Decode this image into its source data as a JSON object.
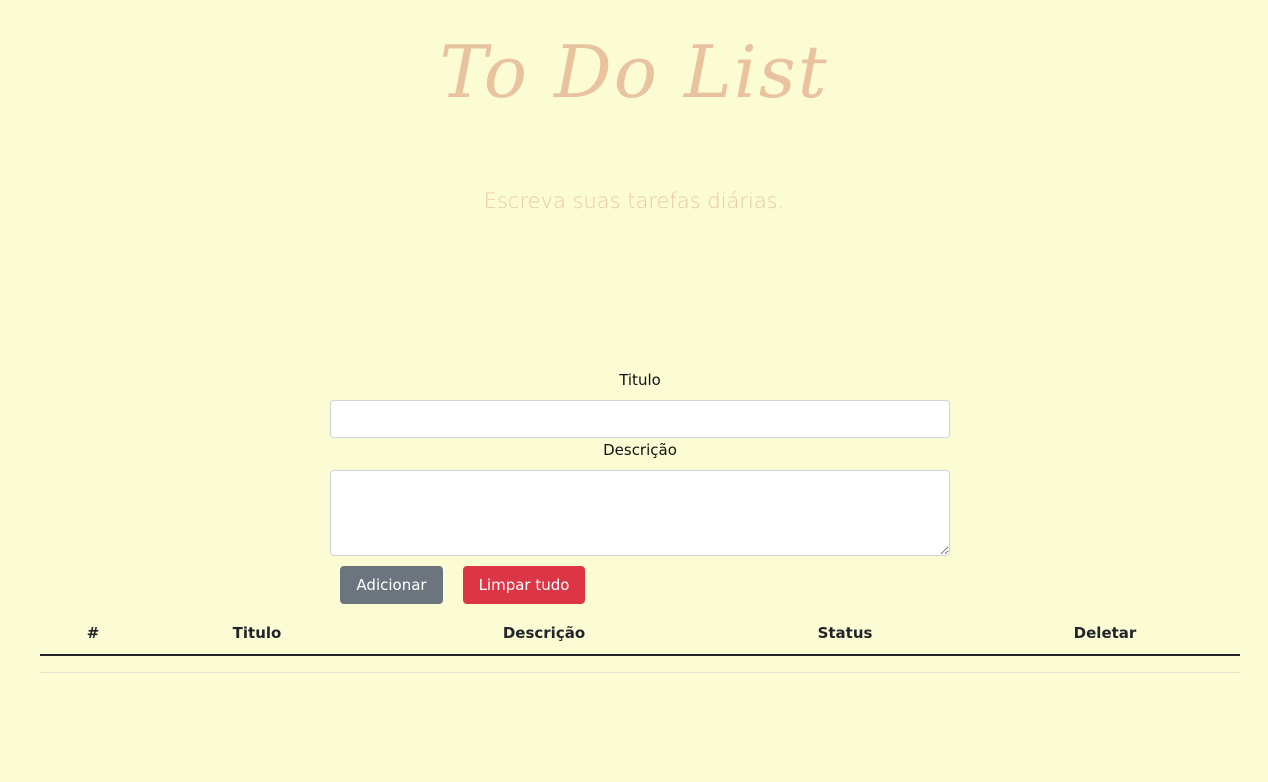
{
  "header": {
    "title": "To Do List",
    "subtitle": "Escreva suas tarefas diárias."
  },
  "form": {
    "title_label": "Titulo",
    "title_value": "",
    "title_placeholder": "",
    "description_label": "Descrição",
    "description_value": "",
    "description_placeholder": "",
    "add_button_label": "Adicionar",
    "clear_button_label": "Limpar tudo"
  },
  "table": {
    "columns": [
      "#",
      "Titulo",
      "Descrição",
      "Status",
      "Deletar"
    ],
    "rows": []
  },
  "colors": {
    "background": "#fbfcd4",
    "title": "#e9c3a0",
    "add_button": "#6c757d",
    "clear_button": "#dc3545"
  }
}
